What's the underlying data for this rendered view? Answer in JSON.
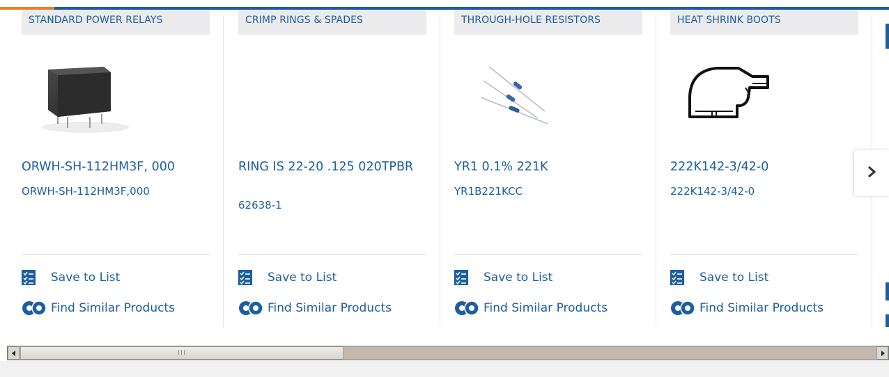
{
  "colors": {
    "link": "#1b5fa0",
    "top_bar": "#1d5f9e",
    "top_accent": "#e8822c"
  },
  "products": [
    {
      "category": "STANDARD POWER RELAYS",
      "title": "ORWH-SH-112HM3F, 000",
      "part_number": "ORWH-SH-112HM3F,000",
      "image_icon": "relay-image"
    },
    {
      "category": "CRIMP RINGS & SPADES",
      "title": "RING IS 22-20 .125 020TPBR",
      "part_number": "62638-1",
      "image_icon": "none"
    },
    {
      "category": "THROUGH-HOLE RESISTORS",
      "title": "YR1 0.1% 221K",
      "part_number": "YR1B221KCC",
      "image_icon": "resistor-image"
    },
    {
      "category": "HEAT SHRINK BOOTS",
      "title": "222K142-3/42-0",
      "part_number": "222K142-3/42-0",
      "image_icon": "boot-image"
    }
  ],
  "actions": {
    "save_label": "Save to List",
    "similar_label": "Find Similar Products"
  },
  "navigation": {
    "next_icon": "chevron-right-icon"
  },
  "scrollbar": {
    "left_icon": "triangle-left-icon",
    "right_icon": "triangle-right-icon",
    "grip": "III"
  }
}
